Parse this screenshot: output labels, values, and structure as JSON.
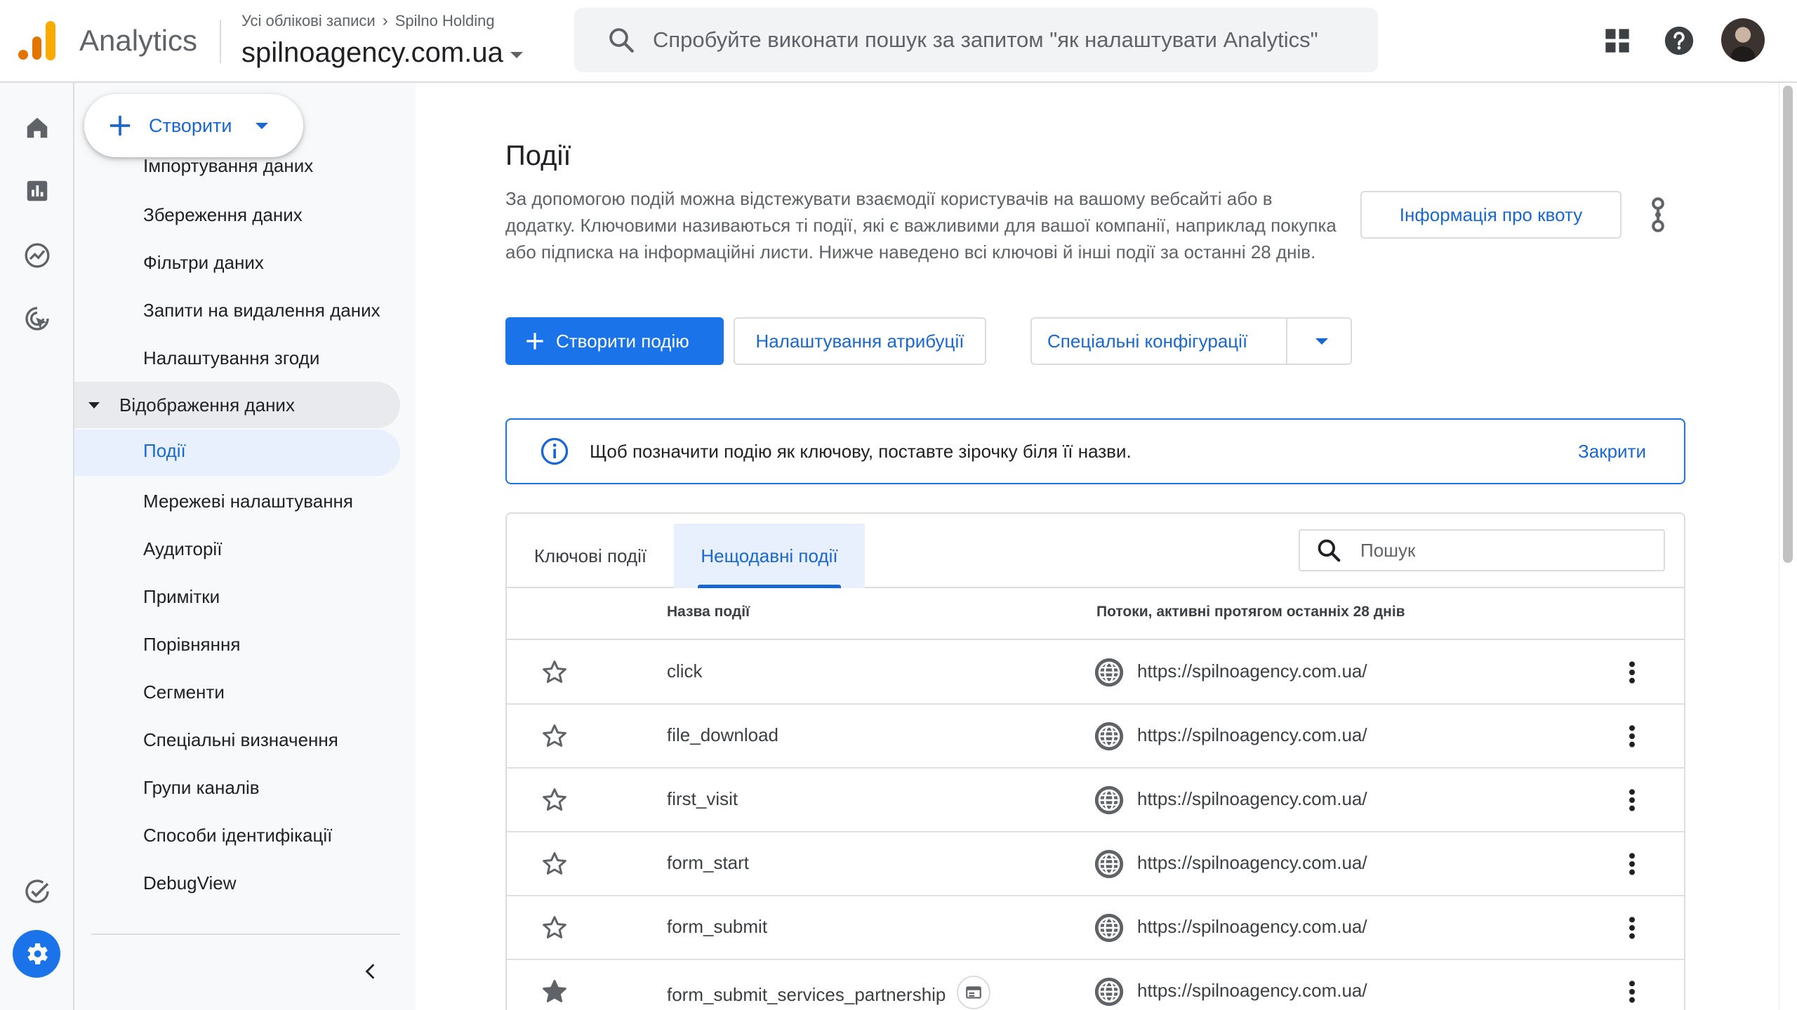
{
  "header": {
    "product_name": "Analytics",
    "breadcrumb": [
      "Усі облікові записи",
      "Spilno Holding"
    ],
    "breadcrumb_sep": "›",
    "property_name": "spilnoagency.com.ua",
    "search_placeholder": "Спробуйте виконати пошук за запитом \"як налаштувати Analytics\"",
    "logo_colors": [
      "#f9ab00",
      "#e37400"
    ]
  },
  "rail": {
    "icons": [
      "home-icon",
      "reports-icon",
      "explore-icon",
      "advertising-icon",
      "configure-check-icon",
      "admin-gear-icon"
    ],
    "accent": "#1a73e8"
  },
  "nav": {
    "create_label": "Створити",
    "items_top": [
      "Імпортування даних",
      "Збереження даних",
      "Фільтри даних",
      "Запити на видалення даних",
      "Налаштування згоди"
    ],
    "section_label": "Відображення даних",
    "active_item": "Події",
    "items_bottom": [
      "Мережеві налаштування",
      "Аудиторії",
      "Примітки",
      "Порівняння",
      "Сегменти",
      "Спеціальні визначення",
      "Групи каналів",
      "Способи ідентифікації",
      "DebugView"
    ]
  },
  "main": {
    "title": "Події",
    "description": "За допомогою подій можна відстежувати взаємодії користувачів на вашому вебсайті або в додатку. Ключовими називаються ті події, які є важливими для вашої компанії, наприклад покупка або підписка на інформаційні листи. Нижче наведено всі ключові й інші події за останні 28 днів.",
    "quota_button": "Інформація про квоту",
    "create_event_button": "Створити подію",
    "attribution_button": "Налаштування атрибуції",
    "custom_config_button": "Спеціальні конфігурації",
    "banner_message": "Щоб позначити подію як ключову, поставте зірочку біля її назви.",
    "banner_close": "Закрити",
    "tabs": [
      "Ключові події",
      "Нещодавні події"
    ],
    "table_search_placeholder": "Пошук",
    "columns": [
      "Назва події",
      "Потоки, активні протягом останніх 28 днів"
    ],
    "rows": [
      {
        "name": "click",
        "stream": "https://spilnoagency.com.ua/",
        "starred": false
      },
      {
        "name": "file_download",
        "stream": "https://spilnoagency.com.ua/",
        "starred": false
      },
      {
        "name": "first_visit",
        "stream": "https://spilnoagency.com.ua/",
        "starred": false
      },
      {
        "name": "form_start",
        "stream": "https://spilnoagency.com.ua/",
        "starred": false
      },
      {
        "name": "form_submit",
        "stream": "https://spilnoagency.com.ua/",
        "starred": false
      },
      {
        "name": "form_submit_services_partnership",
        "stream": "https://spilnoagency.com.ua/",
        "starred": true
      }
    ]
  }
}
